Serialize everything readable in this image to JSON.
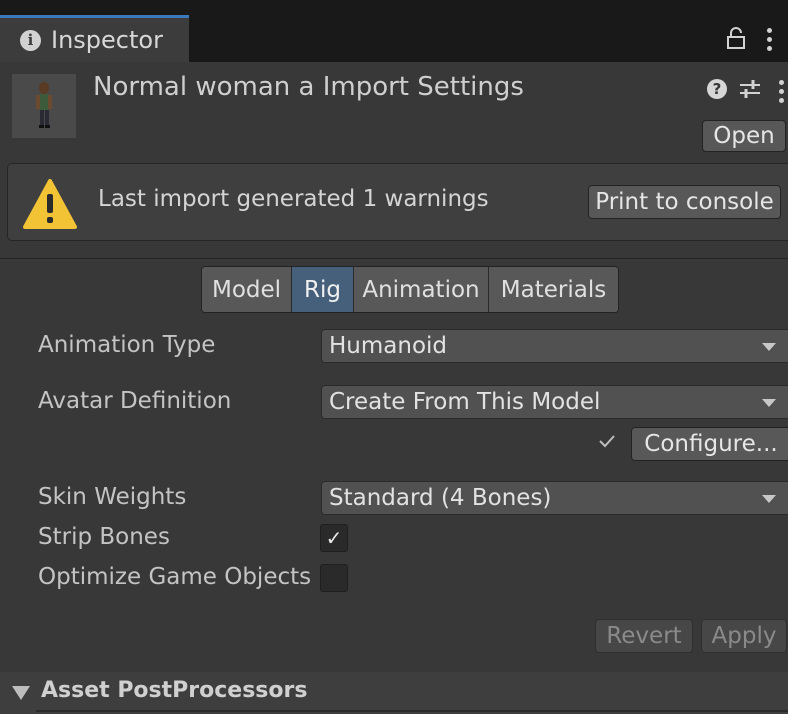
{
  "window": {
    "tab_label": "Inspector",
    "tab_icon": "info-icon",
    "lock_icon": "lock-icon",
    "menu_icon": "kebab-menu-icon"
  },
  "header": {
    "title": "Normal woman a Import Settings",
    "open_label": "Open"
  },
  "warning": {
    "text": "Last import generated 1 warnings",
    "button_label": "Print to console"
  },
  "tabs": [
    {
      "label": "Model",
      "active": false
    },
    {
      "label": "Rig",
      "active": true
    },
    {
      "label": "Animation",
      "active": false
    },
    {
      "label": "Materials",
      "active": false
    }
  ],
  "fields": {
    "animation_type": {
      "label": "Animation Type",
      "value": "Humanoid"
    },
    "avatar_definition": {
      "label": "Avatar Definition",
      "value": "Create From This Model"
    },
    "configure_label": "Configure...",
    "skin_weights": {
      "label": "Skin Weights",
      "value": "Standard (4 Bones)"
    },
    "strip_bones": {
      "label": "Strip Bones",
      "checked": true,
      "mark": "✓"
    },
    "optimize_game_objects": {
      "label": "Optimize Game Objects",
      "checked": false,
      "mark": ""
    }
  },
  "actions": {
    "revert_label": "Revert",
    "apply_label": "Apply"
  },
  "post_processors": {
    "label": "Asset PostProcessors"
  },
  "colors": {
    "background": "#383838",
    "tabbar": "#191919",
    "active_tab": "#46607c",
    "warning": "#f2c335"
  }
}
